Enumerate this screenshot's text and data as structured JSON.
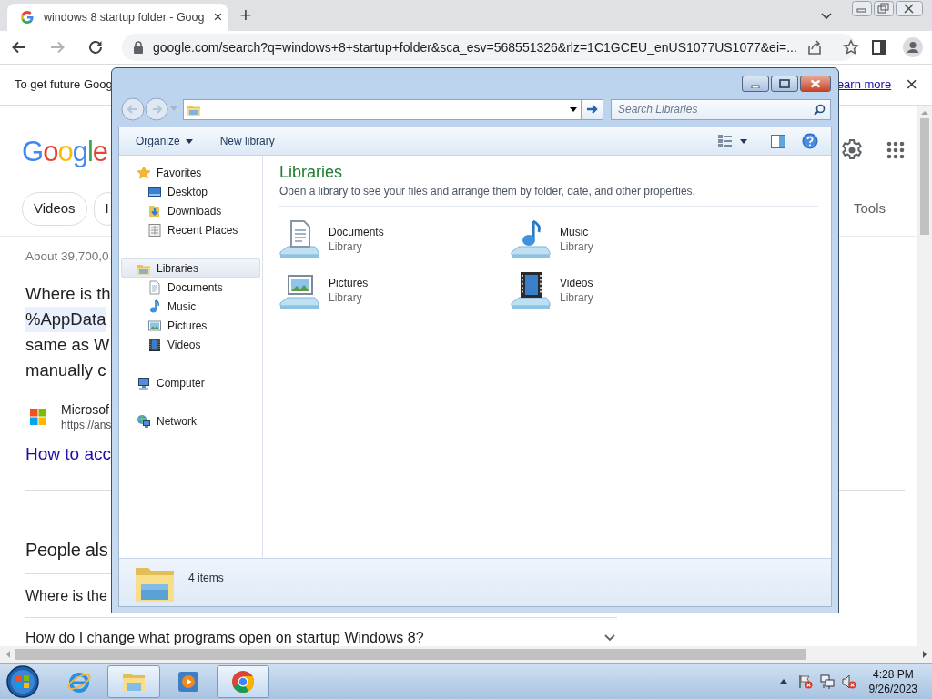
{
  "browser": {
    "tab": {
      "title": "windows 8 startup folder - Goog",
      "close": "×",
      "selected": true
    },
    "new_tab": "+",
    "address": "google.com/search?q=windows+8+startup+folder&sca_esv=568551326&rlz=1C1GCEU_enUS1077US1077&ei=...",
    "info_bar": {
      "text": "To get future Goog",
      "link": "earn more",
      "close": "×"
    }
  },
  "google": {
    "logo": "Google",
    "chips": [
      {
        "label": "Videos"
      },
      {
        "label": "I"
      }
    ],
    "tools": "Tools",
    "result_stats": "About 39,700,0",
    "answer_lines": [
      {
        "text": "Where is th",
        "highlighted": false
      },
      {
        "text": "%AppData",
        "highlighted": true
      },
      {
        "text": "same as W",
        "highlighted": false
      },
      {
        "text": "manually c",
        "highlighted": false
      }
    ],
    "source": {
      "name": "Microsof",
      "url": "https://ans"
    },
    "result_link": "How to acc",
    "people_also_ask": {
      "title": "People als",
      "questions": [
        {
          "text": "Where is the"
        },
        {
          "text": "How do I change what programs open on startup Windows 8?"
        }
      ]
    }
  },
  "explorer": {
    "search": {
      "placeholder": "Search Libraries"
    },
    "toolbar": [
      {
        "label": "Organize",
        "dropdown": true
      },
      {
        "label": "New library",
        "dropdown": false
      }
    ],
    "nav": [
      {
        "label": "Favorites",
        "kind": "favorites",
        "selected": false,
        "children": [
          {
            "label": "Desktop",
            "kind": "desktop",
            "selected": false
          },
          {
            "label": "Downloads",
            "kind": "downloads",
            "selected": false
          },
          {
            "label": "Recent Places",
            "kind": "recent",
            "selected": false
          }
        ]
      },
      {
        "label": "Libraries",
        "kind": "libraries",
        "selected": true,
        "children": [
          {
            "label": "Documents",
            "kind": "documents",
            "selected": false
          },
          {
            "label": "Music",
            "kind": "music",
            "selected": false
          },
          {
            "label": "Pictures",
            "kind": "pictures",
            "selected": false
          },
          {
            "label": "Videos",
            "kind": "videos",
            "selected": false
          }
        ]
      },
      {
        "label": "Computer",
        "kind": "computer",
        "selected": false
      },
      {
        "label": "Network",
        "kind": "network",
        "selected": false
      }
    ],
    "heading": "Libraries",
    "description": "Open a library to see your files and arrange them by folder, date, and other properties.",
    "libraries": [
      {
        "name": "Documents",
        "type": "Library",
        "kind": "documents"
      },
      {
        "name": "Music",
        "type": "Library",
        "kind": "music"
      },
      {
        "name": "Pictures",
        "type": "Library",
        "kind": "pictures"
      },
      {
        "name": "Videos",
        "type": "Library",
        "kind": "videos"
      }
    ],
    "status": "4 items"
  },
  "taskbar": {
    "apps": [
      {
        "kind": "ie",
        "active": false
      },
      {
        "kind": "explorer",
        "active": true
      },
      {
        "kind": "media",
        "active": false
      },
      {
        "kind": "chrome",
        "active": true
      }
    ],
    "time": "4:28 PM",
    "date": "9/26/2023"
  }
}
